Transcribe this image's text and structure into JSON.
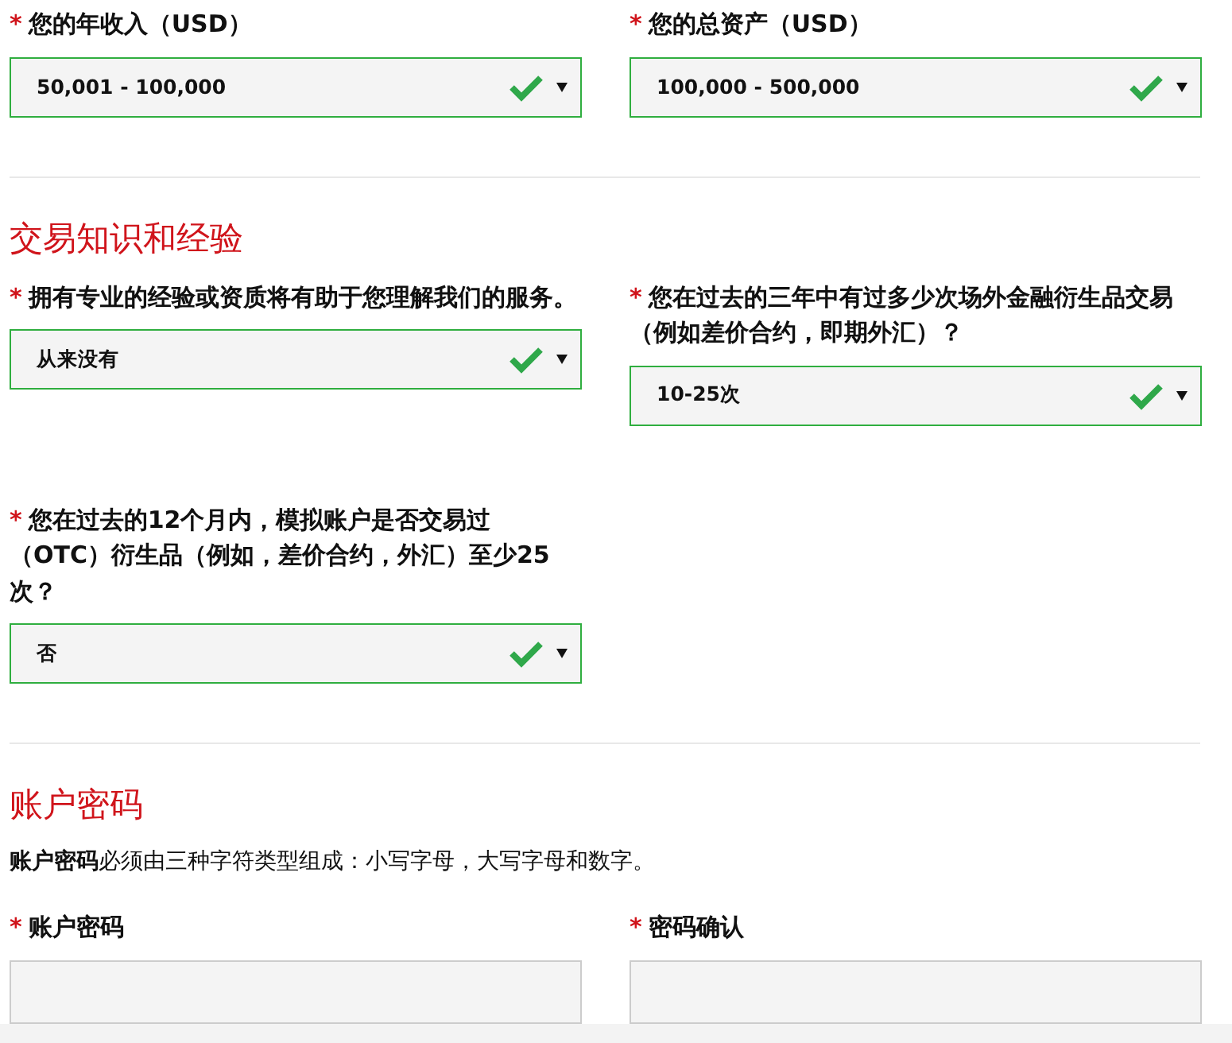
{
  "sections": [
    {
      "fields": [
        {
          "kind": "select",
          "required_mark": "*",
          "label": "您的年收入（USD）",
          "value": "50,001 - 100,000",
          "valid": true
        },
        {
          "kind": "select",
          "required_mark": "*",
          "label": "您的总资产（USD）",
          "value": "100,000 - 500,000",
          "valid": true
        }
      ]
    },
    {
      "heading": "交易知识和经验",
      "fields": [
        {
          "kind": "select",
          "required_mark": "*",
          "label": "拥有专业的经验或资质将有助于您理解我们的服务。",
          "value": "从来没有",
          "valid": true
        },
        {
          "kind": "select",
          "required_mark": "*",
          "label": "您在过去的三年中有过多少次场外金融衍生品交易（例如差价合约，即期外汇）？",
          "value": "10-25次",
          "valid": true
        },
        {
          "kind": "select",
          "required_mark": "*",
          "label": "您在过去的12个月内，模拟账户是否交易过（OTC）衍生品（例如，差价合约，外汇）至少25次？",
          "value": "否",
          "valid": true
        }
      ]
    },
    {
      "heading": "账户密码",
      "note": "**账户密码**必须由三种字符类型组成：小写字母，大写字母和数字。",
      "fields": [
        {
          "kind": "password",
          "required_mark": "*",
          "label": "账户密码",
          "valid": false
        },
        {
          "kind": "password",
          "required_mark": "*",
          "label": "密码确认",
          "valid": false
        }
      ]
    }
  ]
}
